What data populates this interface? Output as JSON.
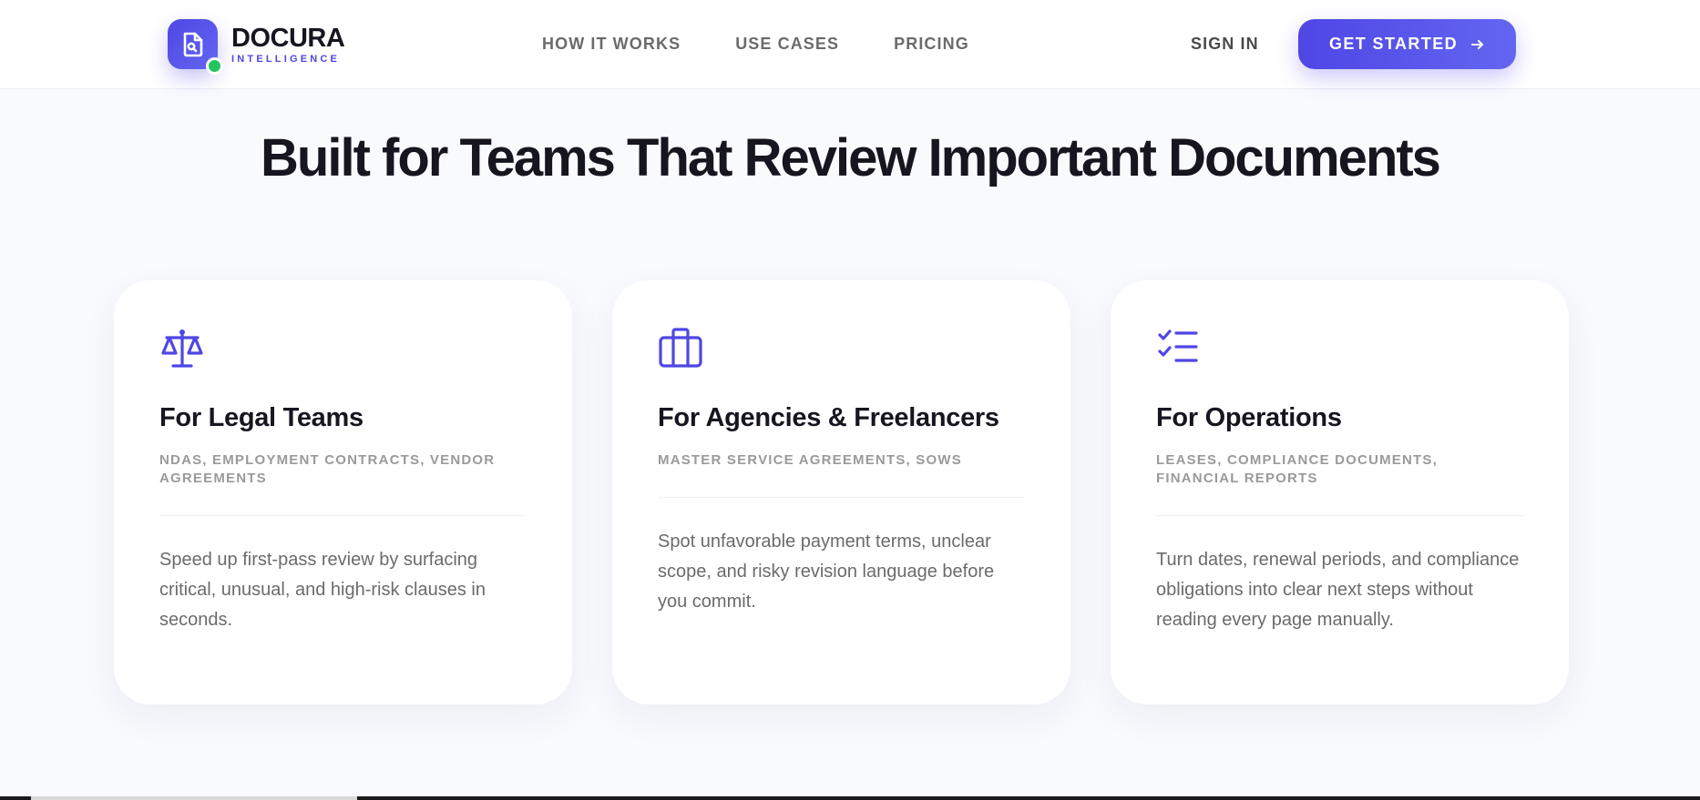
{
  "header": {
    "logo_name": "DOCURA",
    "logo_sub": "INTELLIGENCE",
    "nav": [
      "HOW IT WORKS",
      "USE CASES",
      "PRICING"
    ],
    "sign_in": "SIGN IN",
    "cta": "GET STARTED",
    "accent": "#4f46e5",
    "status_color": "#22c55e"
  },
  "section": {
    "title": "Built for Teams That Review Important Documents"
  },
  "cards": [
    {
      "icon": "scale-icon",
      "title": "For Legal Teams",
      "tags": "NDAS, EMPLOYMENT CONTRACTS, VENDOR AGREEMENTS",
      "description": "Speed up first-pass review by surfacing critical, unusual, and high-risk clauses in seconds."
    },
    {
      "icon": "briefcase-icon",
      "title": "For Agencies & Freelancers",
      "tags": "MASTER SERVICE AGREEMENTS, SOWS",
      "description": "Spot unfavorable payment terms, unclear scope, and risky revision language before you commit."
    },
    {
      "icon": "checklist-icon",
      "title": "For Operations",
      "tags": "LEASES, COMPLIANCE DOCUMENTS, FINANCIAL REPORTS",
      "description": "Turn dates, renewal periods, and compliance obligations into clear next steps without reading every page manually."
    }
  ]
}
